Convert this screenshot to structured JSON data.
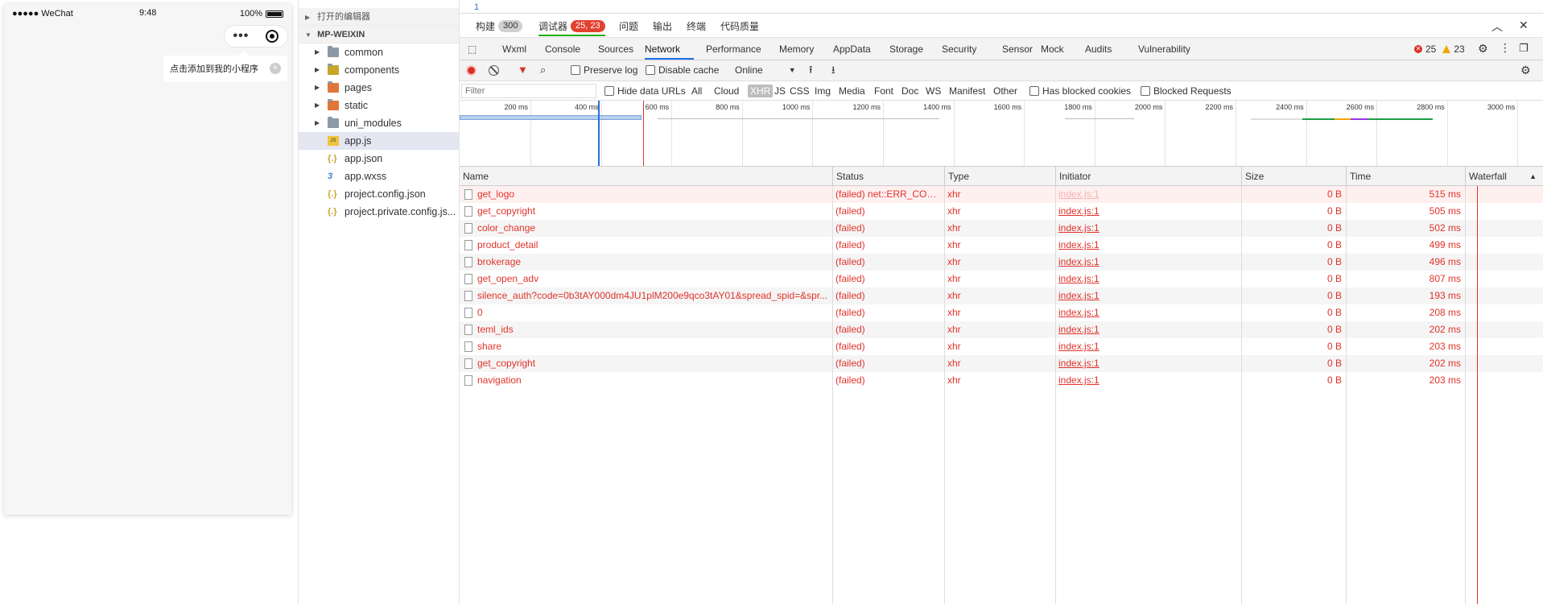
{
  "simulator": {
    "carrier": "●●●●● WeChat",
    "wifi_icon": "wifi-icon",
    "time": "9:48",
    "battery": "100%",
    "capsule_more": "•••",
    "tip_text": "点击添加到我的小程序",
    "tip_close": "×"
  },
  "explorer": {
    "open_editors": "打开的编辑器",
    "project": "MP-WEIXIN",
    "items": [
      {
        "label": "common",
        "type": "folder",
        "color": "#8c9aa7"
      },
      {
        "label": "components",
        "type": "folder",
        "color": "#c9a62b"
      },
      {
        "label": "pages",
        "type": "folder",
        "color": "#e0763a"
      },
      {
        "label": "static",
        "type": "folder",
        "color": "#e0763a"
      },
      {
        "label": "uni_modules",
        "type": "folder",
        "color": "#8c9aa7"
      },
      {
        "label": "app.js",
        "type": "js"
      },
      {
        "label": "app.json",
        "type": "json"
      },
      {
        "label": "app.wxss",
        "type": "css"
      },
      {
        "label": "project.config.json",
        "type": "json"
      },
      {
        "label": "project.private.config.js...",
        "type": "json"
      }
    ]
  },
  "editor": {
    "line_number": "1"
  },
  "top_tabs": {
    "build": "构建",
    "build_count": "300",
    "debugger": "调试器",
    "debugger_count": "25, 23",
    "issues": "问题",
    "output": "输出",
    "terminal": "终端",
    "quality": "代码质量"
  },
  "panels": {
    "tabs": [
      "Wxml",
      "Console",
      "Sources",
      "Network",
      "Performance",
      "Memory",
      "AppData",
      "Storage",
      "Security",
      "Sensor",
      "Mock",
      "Audits",
      "Vulnerability"
    ],
    "active": "Network",
    "errors": "25",
    "warnings": "23"
  },
  "toolbar": {
    "preserve_log": "Preserve log",
    "disable_cache": "Disable cache",
    "throttle": "Online"
  },
  "filter": {
    "placeholder": "Filter",
    "hide_data_urls": "Hide data URLs",
    "types": [
      "All",
      "Cloud",
      "XHR",
      "JS",
      "CSS",
      "Img",
      "Media",
      "Font",
      "Doc",
      "WS",
      "Manifest",
      "Other"
    ],
    "active_type": "XHR",
    "has_blocked_cookies": "Has blocked cookies",
    "blocked_requests": "Blocked Requests"
  },
  "overview": {
    "ticks": [
      "200 ms",
      "400 ms",
      "600 ms",
      "800 ms",
      "1000 ms",
      "1200 ms",
      "1400 ms",
      "1600 ms",
      "1800 ms",
      "2000 ms",
      "2200 ms",
      "2400 ms",
      "2600 ms",
      "2800 ms",
      "3000 ms"
    ]
  },
  "table": {
    "headers": {
      "name": "Name",
      "status": "Status",
      "type": "Type",
      "initiator": "Initiator",
      "size": "Size",
      "time": "Time",
      "waterfall": "Waterfall"
    },
    "rows": [
      {
        "name": "get_logo",
        "status": "(failed) net::ERR_CON...",
        "type": "xhr",
        "initiator": "index.js:1",
        "size": "0 B",
        "time": "515 ms"
      },
      {
        "name": "get_copyright",
        "status": "(failed)",
        "type": "xhr",
        "initiator": "index.js:1",
        "size": "0 B",
        "time": "505 ms"
      },
      {
        "name": "color_change",
        "status": "(failed)",
        "type": "xhr",
        "initiator": "index.js:1",
        "size": "0 B",
        "time": "502 ms"
      },
      {
        "name": "product_detail",
        "status": "(failed)",
        "type": "xhr",
        "initiator": "index.js:1",
        "size": "0 B",
        "time": "499 ms"
      },
      {
        "name": "brokerage",
        "status": "(failed)",
        "type": "xhr",
        "initiator": "index.js:1",
        "size": "0 B",
        "time": "496 ms"
      },
      {
        "name": "get_open_adv",
        "status": "(failed)",
        "type": "xhr",
        "initiator": "index.js:1",
        "size": "0 B",
        "time": "807 ms"
      },
      {
        "name": "silence_auth?code=0b3tAY000dm4JU1plM200e9qco3tAY01&spread_spid=&spr...",
        "status": "(failed)",
        "type": "xhr",
        "initiator": "index.js:1",
        "size": "0 B",
        "time": "193 ms"
      },
      {
        "name": "0",
        "status": "(failed)",
        "type": "xhr",
        "initiator": "index.js:1",
        "size": "0 B",
        "time": "208 ms"
      },
      {
        "name": "teml_ids",
        "status": "(failed)",
        "type": "xhr",
        "initiator": "index.js:1",
        "size": "0 B",
        "time": "202 ms"
      },
      {
        "name": "share",
        "status": "(failed)",
        "type": "xhr",
        "initiator": "index.js:1",
        "size": "0 B",
        "time": "203 ms"
      },
      {
        "name": "get_copyright",
        "status": "(failed)",
        "type": "xhr",
        "initiator": "index.js:1",
        "size": "0 B",
        "time": "202 ms"
      },
      {
        "name": "navigation",
        "status": "(failed)",
        "type": "xhr",
        "initiator": "index.js:1",
        "size": "0 B",
        "time": "203 ms"
      }
    ]
  },
  "colors": {
    "error": "#e0332a",
    "accent": "#1a73e8",
    "wechat_green": "#1aad19"
  }
}
